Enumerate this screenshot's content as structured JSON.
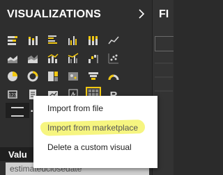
{
  "panel": {
    "title": "VISUALIZATIONS",
    "right_title_partial": "FI"
  },
  "icons": [
    "stacked-bar-icon",
    "stacked-column-icon",
    "clustered-bar-icon",
    "clustered-column-icon",
    "100-percent-bar-icon",
    "line-icon",
    "area-icon",
    "stacked-area-icon",
    "line-column-icon",
    "line-clustered-column-icon",
    "waterfall-icon",
    "scatter-icon",
    "pie-icon",
    "donut-icon",
    "treemap-icon",
    "map-icon",
    "funnel-icon",
    "gauge-icon",
    "card-icon",
    "multirow-card-icon",
    "kpi-icon",
    "slicer-icon",
    "table-icon",
    "r-visual-icon",
    "globe-icon"
  ],
  "selected_icon": "table-icon",
  "r_label": "R",
  "more_label": "...",
  "context_menu": {
    "items": [
      "Import from file",
      "Import from marketplace",
      "Delete a custom visual"
    ],
    "highlighted_index": 1
  },
  "values_section": {
    "label": "Valu",
    "field": "estimatedclosedate"
  },
  "colors": {
    "highlight": "#f4f36a",
    "selected_border": "#f2c811",
    "panel_bg": "#2e2e2e"
  }
}
